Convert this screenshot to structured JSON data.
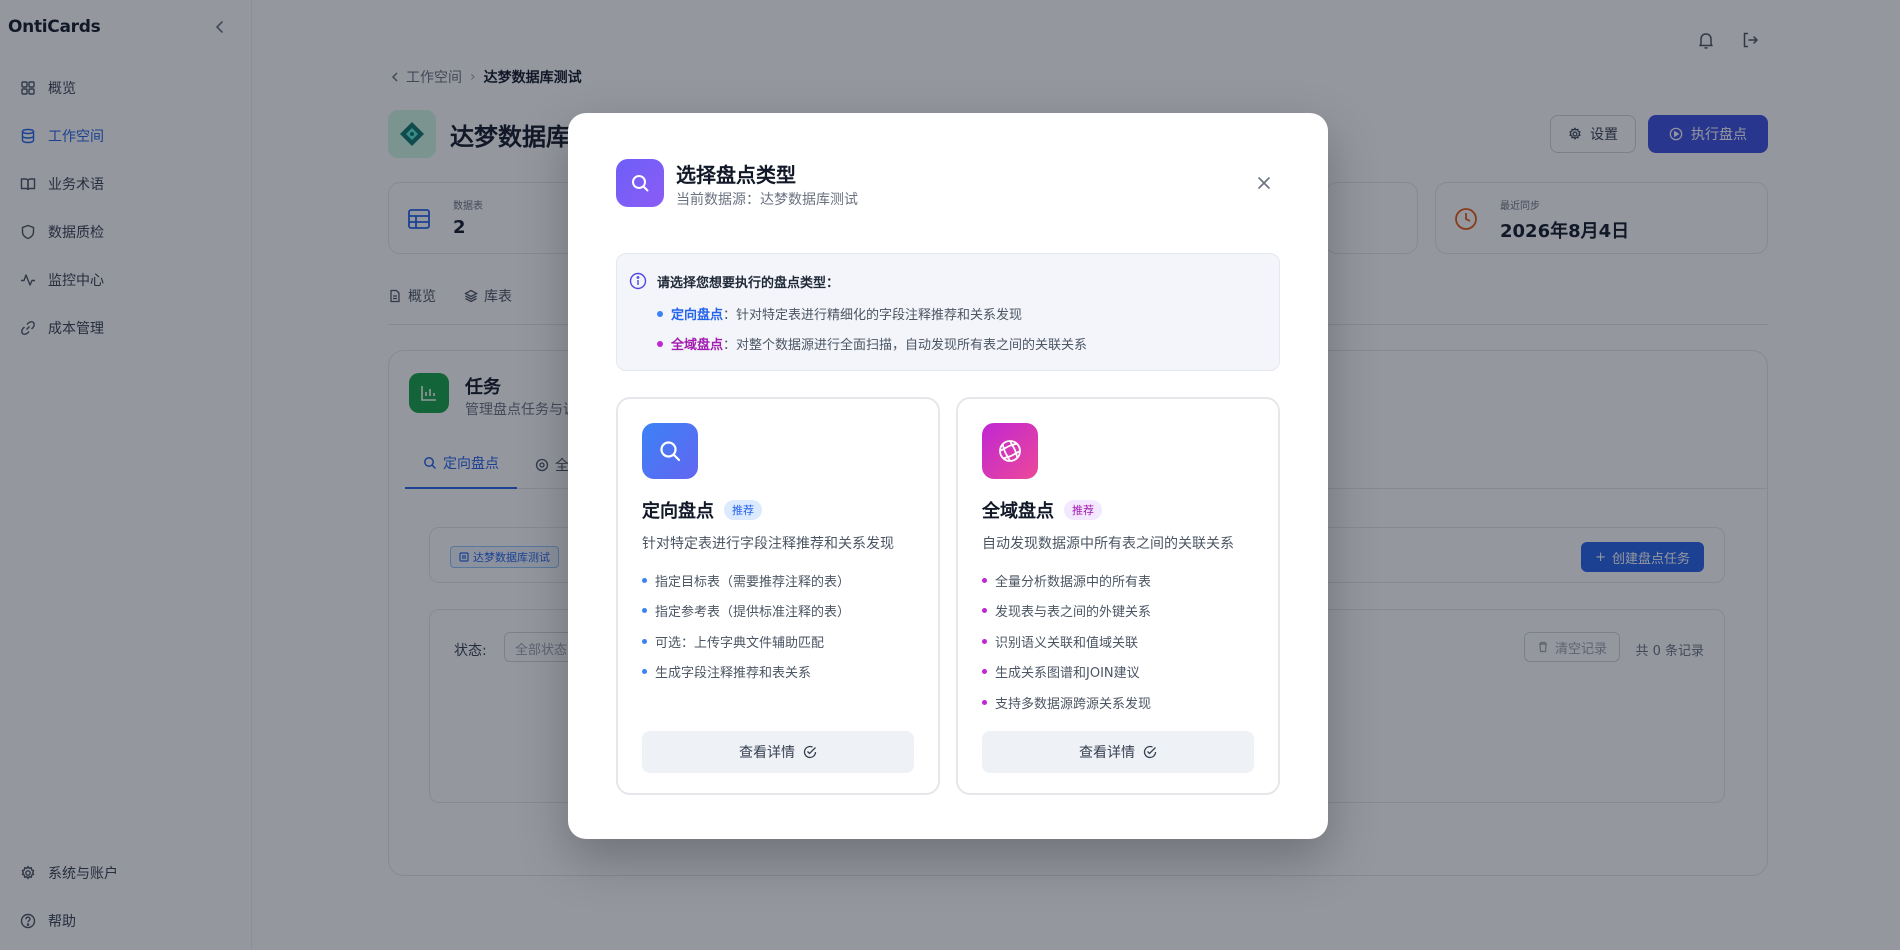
{
  "app": {
    "brand": "OntiCards"
  },
  "sidebar": {
    "items": [
      {
        "label": "概览",
        "icon": "grid-icon",
        "active": false
      },
      {
        "label": "工作空间",
        "icon": "database-icon",
        "active": true
      },
      {
        "label": "业务术语",
        "icon": "book-icon",
        "active": false
      },
      {
        "label": "数据质检",
        "icon": "shield-icon",
        "active": false
      },
      {
        "label": "监控中心",
        "icon": "activity-icon",
        "active": false
      },
      {
        "label": "成本管理",
        "icon": "link-icon",
        "active": false
      }
    ],
    "bottom": [
      {
        "label": "系统与账户",
        "icon": "gear-icon"
      },
      {
        "label": "帮助",
        "icon": "help-icon"
      }
    ]
  },
  "breadcrumb": {
    "back": "工作空间",
    "current": "达梦数据库测试"
  },
  "page": {
    "title": "达梦数据库测试",
    "settings_label": "设置",
    "run_label": "执行盘点"
  },
  "stats": {
    "tables": {
      "label": "数据表",
      "value": "2"
    },
    "last_sync": {
      "label": "最近同步",
      "value": "2026年8月4日"
    }
  },
  "top_tabs": [
    {
      "label": "概览"
    },
    {
      "label": "库表"
    }
  ],
  "task": {
    "title": "任务",
    "subtitle": "管理盘点任务与调",
    "tab_active": "定向盘点",
    "tab_second": "全",
    "datasource_tag": "达梦数据库测试",
    "create_label": "创建盘点任务",
    "status_label": "状态:",
    "status_placeholder": "全部状态",
    "clear_label": "清空记录",
    "record_count": "共 0 条记录"
  },
  "modal": {
    "title": "选择盘点类型",
    "subtitle": "当前数据源：达梦数据库测试",
    "info": {
      "heading": "请选择您想要执行的盘点类型：",
      "line1_kw": "定向盘点",
      "line1_text": "：针对特定表进行精细化的字段注释推荐和关系发现",
      "line2_kw": "全域盘点",
      "line2_text": "：对整个数据源进行全面扫描，自动发现所有表之间的关联关系"
    },
    "cards": [
      {
        "title": "定向盘点",
        "badge": "推荐",
        "desc": "针对特定表进行字段注释推荐和关系发现",
        "features": [
          "指定目标表（需要推荐注释的表）",
          "指定参考表（提供标准注释的表）",
          "可选：上传字典文件辅助匹配",
          "生成字段注释推荐和表关系"
        ],
        "button": "查看详情",
        "accent": "#3b82f6"
      },
      {
        "title": "全域盘点",
        "badge": "推荐",
        "desc": "自动发现数据源中所有表之间的关联关系",
        "features": [
          "全量分析数据源中的所有表",
          "发现表与表之间的外键关系",
          "识别语义关联和值域关联",
          "生成关系图谱和JOIN建议",
          "支持多数据源跨源关系发现"
        ],
        "button": "查看详情",
        "accent": "#c026d3"
      }
    ]
  }
}
